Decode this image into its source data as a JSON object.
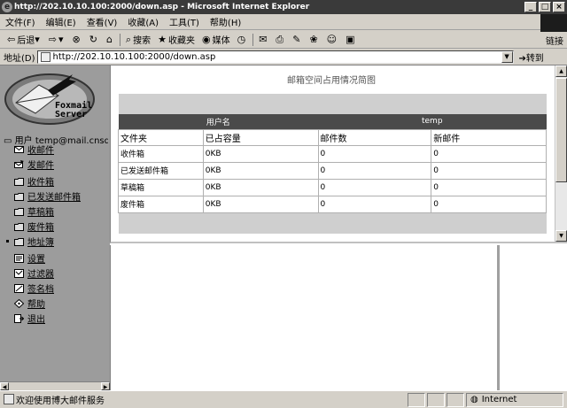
{
  "window": {
    "title": "http://202.10.10.100:2000/down.asp - Microsoft Internet Explorer",
    "logo_letter": "e"
  },
  "menu": [
    "文件(F)",
    "编辑(E)",
    "查看(V)",
    "收藏(A)",
    "工具(T)",
    "帮助(H)"
  ],
  "toolbar": {
    "back": "后退",
    "search": "搜索",
    "favorites": "收藏夹",
    "media": "媒体",
    "links": "链接"
  },
  "address": {
    "label": "地址(D)",
    "url": "http://202.10.10.100:2000/down.asp",
    "go": "转到"
  },
  "sidebar": {
    "logo_line1": "Foxmail",
    "logo_line2": "Server",
    "user": "用户 temp@mail.cnsd",
    "items": [
      {
        "label": "收邮件",
        "icon": "inbox-icon"
      },
      {
        "label": "发邮件",
        "icon": "send-mail-icon"
      },
      {
        "label": "收件箱",
        "icon": "folder-icon"
      },
      {
        "label": "已发送邮件箱",
        "icon": "folder-icon"
      },
      {
        "label": "草稿箱",
        "icon": "folder-icon"
      },
      {
        "label": "废件箱",
        "icon": "folder-icon"
      },
      {
        "label": "地址簿",
        "icon": "folder-icon"
      },
      {
        "label": "设置",
        "icon": "settings-icon"
      },
      {
        "label": "过滤器",
        "icon": "filter-icon"
      },
      {
        "label": "签名档",
        "icon": "signature-icon"
      },
      {
        "label": "帮助",
        "icon": "help-icon"
      },
      {
        "label": "退出",
        "icon": "exit-icon"
      }
    ]
  },
  "main": {
    "title": "邮箱空间占用情况简图",
    "user_label": "用户名",
    "user_value": "temp",
    "columns": [
      "文件夹",
      "已占容量",
      "邮件数",
      "新邮件"
    ],
    "rows": [
      [
        "收件箱",
        "0KB",
        "0",
        "0"
      ],
      [
        "已发送邮件箱",
        "0KB",
        "0",
        "0"
      ],
      [
        "草稿箱",
        "0KB",
        "0",
        "0"
      ],
      [
        "废件箱",
        "0KB",
        "0",
        "0"
      ]
    ]
  },
  "status": {
    "message": "欢迎使用博大邮件服务",
    "zone": "Internet"
  },
  "colors": {
    "titlebar": "#3a3a3a",
    "sidebar": "#9c9c9c",
    "table_header": "#4a4a4a",
    "table_band": "#cfcfcf"
  }
}
